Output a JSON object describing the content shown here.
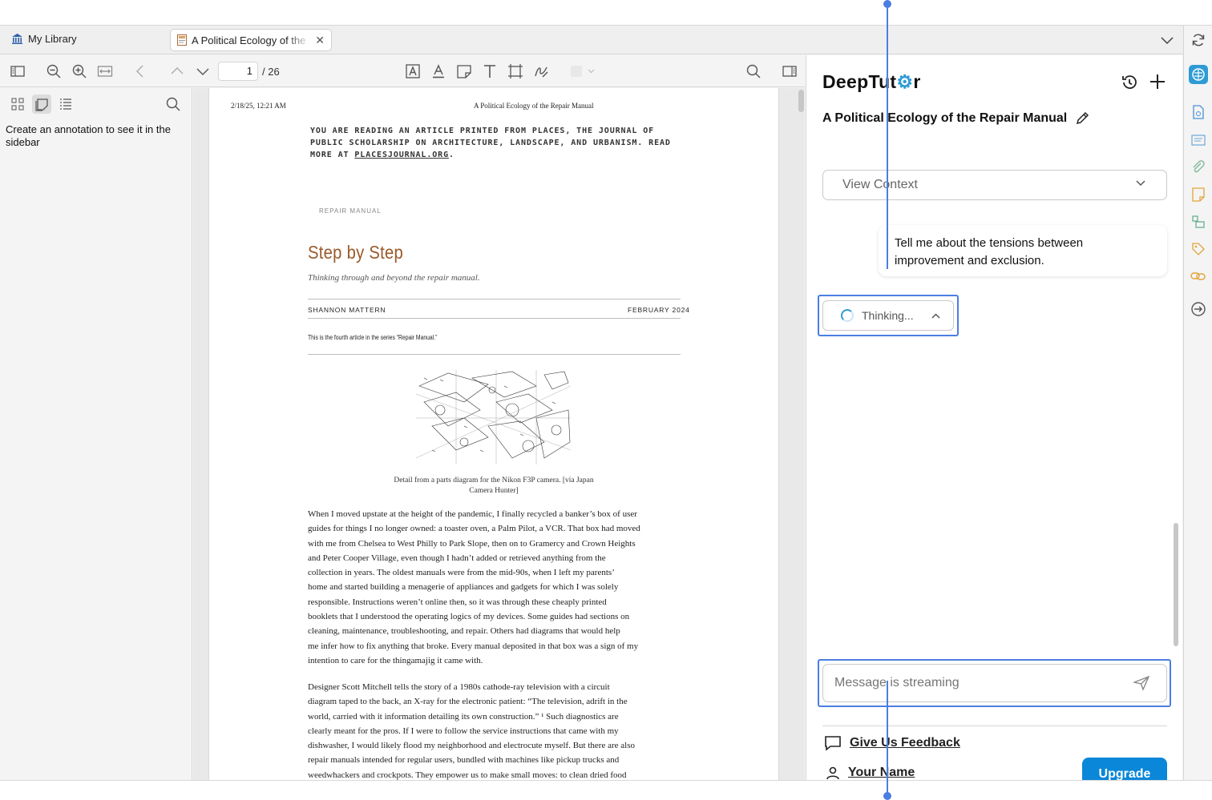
{
  "tabs": {
    "library_label": "My Library",
    "doc_tab_title": "A Political Ecology of the Repair Manual"
  },
  "toolbar": {
    "page_current": "1",
    "page_total": "/ 26"
  },
  "annotations_sidebar": {
    "empty_message": "Create an annotation to see it in the sidebar"
  },
  "pdf": {
    "print_date": "2/18/25, 12:21 AM",
    "running_head": "A Political Ecology of the Repair Manual",
    "notice_prefix": "YOU ARE READING AN ARTICLE PRINTED FROM PLACES, THE JOURNAL OF PUBLIC SCHOLARSHIP ON ARCHITECTURE, LANDSCAPE, AND URBANISM. READ MORE AT ",
    "notice_link": "PLACESJOURNAL.ORG",
    "notice_suffix": ".",
    "kicker": "REPAIR MANUAL",
    "title": "Step by Step",
    "subtitle": "Thinking through and beyond the repair manual.",
    "author": "SHANNON MATTERN",
    "date": "FEBRUARY 2024",
    "series_note": "This is the fourth article in the series “Repair Manual.”",
    "figure_caption": "Detail from a parts diagram for the Nikon F3P camera. [via Japan Camera Hunter]",
    "paragraph1": "When I moved upstate at the height of the pandemic, I finally recycled a banker’s box of user\nguides for things I no longer owned: a toaster oven, a Palm Pilot, a VCR. That box had moved\nwith me from Chelsea to West Philly to Park Slope, then on to Gramercy and Crown Heights\nand Peter Cooper Village, even though I hadn’t added or retrieved anything from the\ncollection in years. The oldest manuals were from the mid-90s, when I left my parents’\nhome and started building a menagerie of appliances and gadgets for which I was solely\nresponsible. Instructions weren’t online then, so it was through these cheaply printed\nbooklets that I understood the operating logics of my devices. Some guides had sections on\ncleaning, maintenance, troubleshooting, and repair. Others had diagrams that would help\nme infer how to fix anything that broke. Every manual deposited in that box was a sign of my\nintention to care for the thingamajig it came with.",
    "paragraph2": "Designer Scott Mitchell tells the story of a 1980s cathode-ray television with a circuit\ndiagram taped to the back, an X-ray for the electronic patient: “The television, adrift in the\nworld, carried with it information detailing its own construction.” ¹ Such diagnostics are\nclearly meant for the pros. If I were to follow the service instructions that came with my\ndishwasher, I would likely flood my neighborhood and electrocute myself. But there are also\nrepair manuals intended for regular users, bundled with machines like pickup trucks and\nweedwhackers and crockpots. They empower us to make small moves: to clean dried food"
  },
  "panel": {
    "logo_prefix": "DeepTut",
    "logo_suffix": "r",
    "doc_title": "A Political Ecology of the Repair Manual",
    "view_context_label": "View Context",
    "user_message": "Tell me about the tensions between improvement and exclusion.",
    "thinking_label": "Thinking...",
    "input_placeholder": "Message is streaming",
    "feedback_label": "Give Us Feedback",
    "user_name": "Your Name",
    "upgrade_label": "Upgrade"
  },
  "colors": {
    "accent": "#0a87d8",
    "deeptutor_blue": "#2e9bd6",
    "title_brown": "#9a5a2a",
    "highlight_outline": "#4b7ee3"
  },
  "icons": [
    "library-icon",
    "pdf-icon",
    "close-icon",
    "chevron-down-icon",
    "sync-icon",
    "sidebar-toggle-icon",
    "zoom-out-icon",
    "zoom-in-icon",
    "fit-width-icon",
    "back-icon",
    "page-up-icon",
    "page-down-icon",
    "highlight-icon",
    "underline-icon",
    "note-icon",
    "text-icon",
    "area-icon",
    "ink-icon",
    "search-icon",
    "context-pane-icon",
    "history-icon",
    "plus-icon",
    "pencil-icon",
    "send-icon",
    "chat-icon",
    "user-icon"
  ]
}
